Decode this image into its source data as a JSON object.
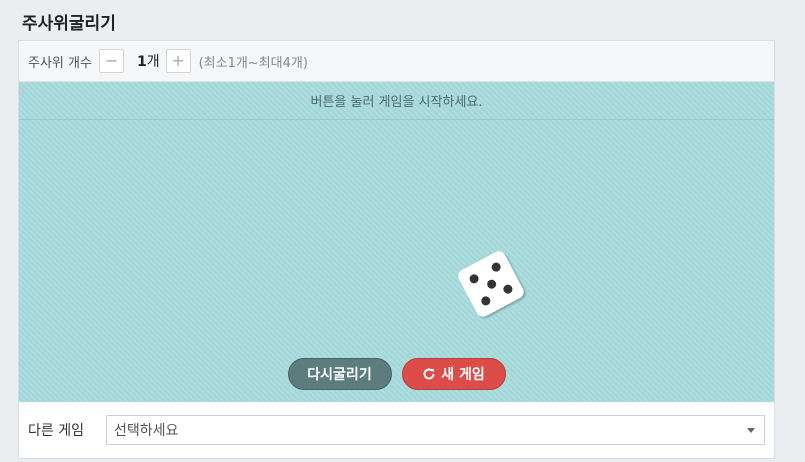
{
  "page": {
    "title": "주사위굴리기"
  },
  "toolbar": {
    "dice_label": "주사위 개수",
    "minus": "−",
    "plus": "+",
    "count_number": "1",
    "count_unit": "개",
    "range_hint": "(최소1개~최대4개)"
  },
  "game": {
    "message": "버튼을 눌러 게임을 시작하세요.",
    "die_face": 5,
    "reroll_label": "다시굴리기",
    "new_game_label": "새 게임"
  },
  "other_games": {
    "label": "다른 게임",
    "select_value": "선택하세요"
  },
  "colors": {
    "game_bg": "#a6dadb",
    "reroll_btn": "#5d7c7e",
    "new_game_btn": "#dc4c48"
  }
}
